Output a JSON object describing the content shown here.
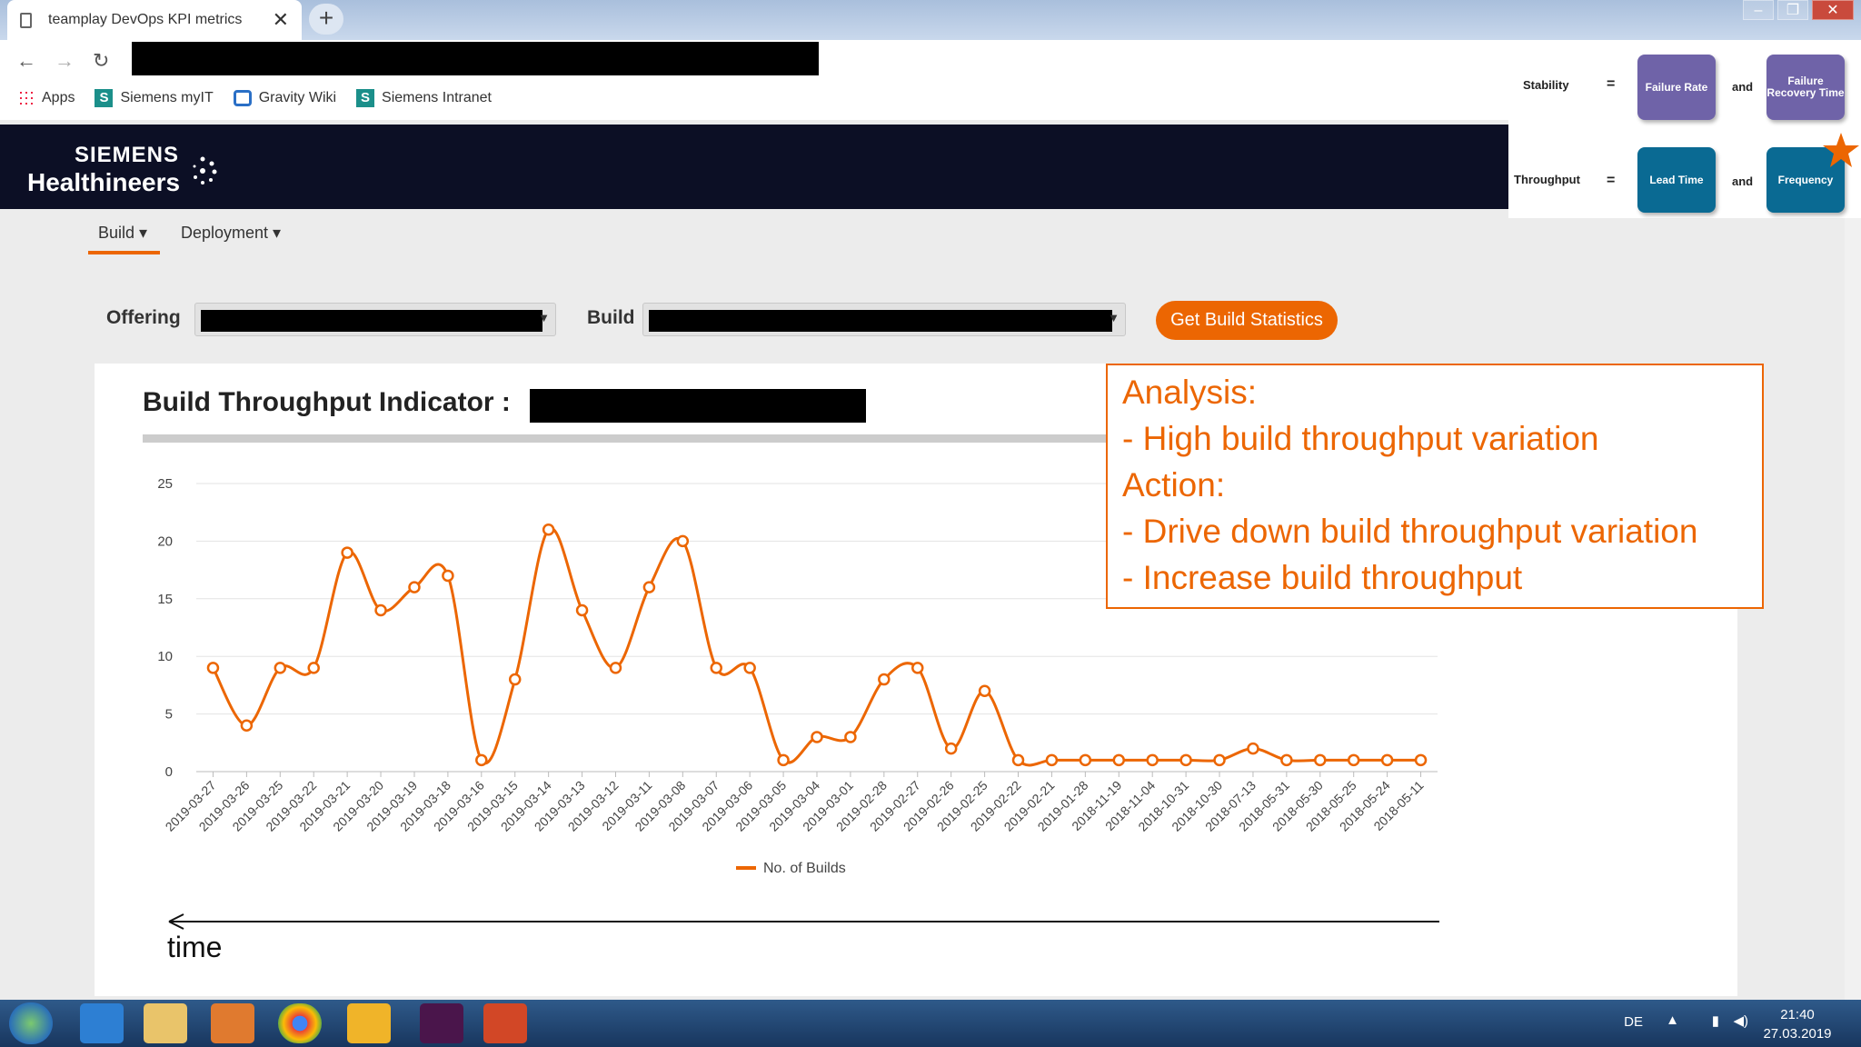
{
  "browser": {
    "tab_title": "teamplay DevOps KPI metrics",
    "bookmarks": [
      "Apps",
      "Siemens myIT",
      "Gravity Wiki",
      "Siemens Intranet"
    ]
  },
  "header": {
    "logo_line1": "SIEMENS",
    "logo_line2": "Healthineers"
  },
  "kpi": {
    "stability_label": "Stability",
    "throughput_label": "Throughput",
    "eq": "=",
    "and": "and",
    "failure_rate": "Failure Rate",
    "failure_recovery": "Failure Recovery Time",
    "lead_time": "Lead Time",
    "frequency": "Frequency"
  },
  "nav": {
    "build": "Build ▾",
    "deployment": "Deployment ▾"
  },
  "filters": {
    "offering_label": "Offering",
    "build_label": "Build",
    "button": "Get Build Statistics"
  },
  "chart_title": "Build Throughput Indicator :",
  "analysis": [
    "Analysis:",
    "- High build throughput variation",
    "Action:",
    "- Drive down build throughput variation",
    "- Increase build throughput"
  ],
  "time_label": "time",
  "taskbar": {
    "lang": "DE",
    "time": "21:40",
    "date": "27.03.2019"
  },
  "colors": {
    "accent": "#ec6602",
    "header_bg": "#0c0f25"
  },
  "chart_data": {
    "type": "line",
    "x": [
      "2019-03-27",
      "2019-03-26",
      "2019-03-25",
      "2019-03-22",
      "2019-03-21",
      "2019-03-20",
      "2019-03-19",
      "2019-03-18",
      "2019-03-16",
      "2019-03-15",
      "2019-03-14",
      "2019-03-13",
      "2019-03-12",
      "2019-03-11",
      "2019-03-08",
      "2019-03-07",
      "2019-03-06",
      "2019-03-05",
      "2019-03-04",
      "2019-03-01",
      "2019-02-28",
      "2019-02-27",
      "2019-02-26",
      "2019-02-25",
      "2019-02-22",
      "2019-02-21",
      "2019-01-28",
      "2018-11-19",
      "2018-11-04",
      "2018-10-31",
      "2018-10-30",
      "2018-07-13",
      "2018-05-31",
      "2018-05-30",
      "2018-05-25",
      "2018-05-24",
      "2018-05-11"
    ],
    "series": [
      {
        "name": "No. of Builds",
        "values": [
          9,
          4,
          9,
          9,
          19,
          14,
          16,
          17,
          1,
          8,
          21,
          14,
          9,
          16,
          20,
          9,
          9,
          1,
          3,
          3,
          8,
          9,
          2,
          7,
          1,
          1,
          1,
          1,
          1,
          1,
          1,
          2,
          1,
          1,
          1,
          1,
          1
        ]
      }
    ],
    "y_ticks": [
      0,
      5,
      10,
      15,
      20,
      25
    ],
    "ylim": [
      0,
      25
    ],
    "grid": true,
    "legend": "bottom"
  }
}
